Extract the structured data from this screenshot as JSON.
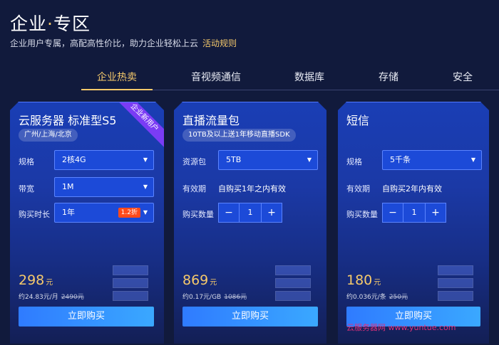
{
  "hero": {
    "title_main": "企业",
    "title_sep": "·",
    "title_accent": "专区",
    "subtitle": "企业用户专属，高配高性价比，助力企业轻松上云",
    "rules_link": "活动规则"
  },
  "tabs": [
    "企业热卖",
    "音视频通信",
    "数据库",
    "存储",
    "安全"
  ],
  "cards": [
    {
      "title": "云服务器 标准型S5",
      "chip": "广州/上海/北京",
      "ribbon": "企业新用户",
      "rows": [
        {
          "label": "规格",
          "value": "2核4G"
        },
        {
          "label": "带宽",
          "value": "1M"
        },
        {
          "label": "购买时长",
          "value": "1年",
          "badge": "1.2折"
        }
      ],
      "price": "298",
      "price_unit": "元",
      "sub_price": "约24.83元/月",
      "old_price": "2490元",
      "buy_label": "立即购买"
    },
    {
      "title": "直播流量包",
      "chip": "10TB及以上送1年移动直播SDK",
      "rows": [
        {
          "label": "资源包",
          "value": "5TB"
        },
        {
          "label": "有效期",
          "value": "自购买1年之内有效"
        },
        {
          "label": "购买数量",
          "value": "1"
        }
      ],
      "price": "869",
      "price_unit": "元",
      "sub_price": "约0.17元/GB",
      "old_price": "1086元",
      "buy_label": "立即购买"
    },
    {
      "title": "短信",
      "rows": [
        {
          "label": "规格",
          "value": "5千条"
        },
        {
          "label": "有效期",
          "value": "自购买2年内有效"
        },
        {
          "label": "购买数量",
          "value": "1"
        }
      ],
      "price": "180",
      "price_unit": "元",
      "sub_price": "约0.036元/条",
      "old_price": "250元",
      "buy_label": "立即购买"
    }
  ],
  "stepper": {
    "minus": "−",
    "plus": "+"
  },
  "watermark": "云服务器网 www.yuntue.com",
  "colors": {
    "background": "#111a3c",
    "accent_gold": "#f5c96b",
    "card_blue": "#1a3eb5",
    "field_blue": "#1c4ad8",
    "discount_red": "#ff4a1c",
    "ribbon_purple": "#7a3cf5"
  }
}
